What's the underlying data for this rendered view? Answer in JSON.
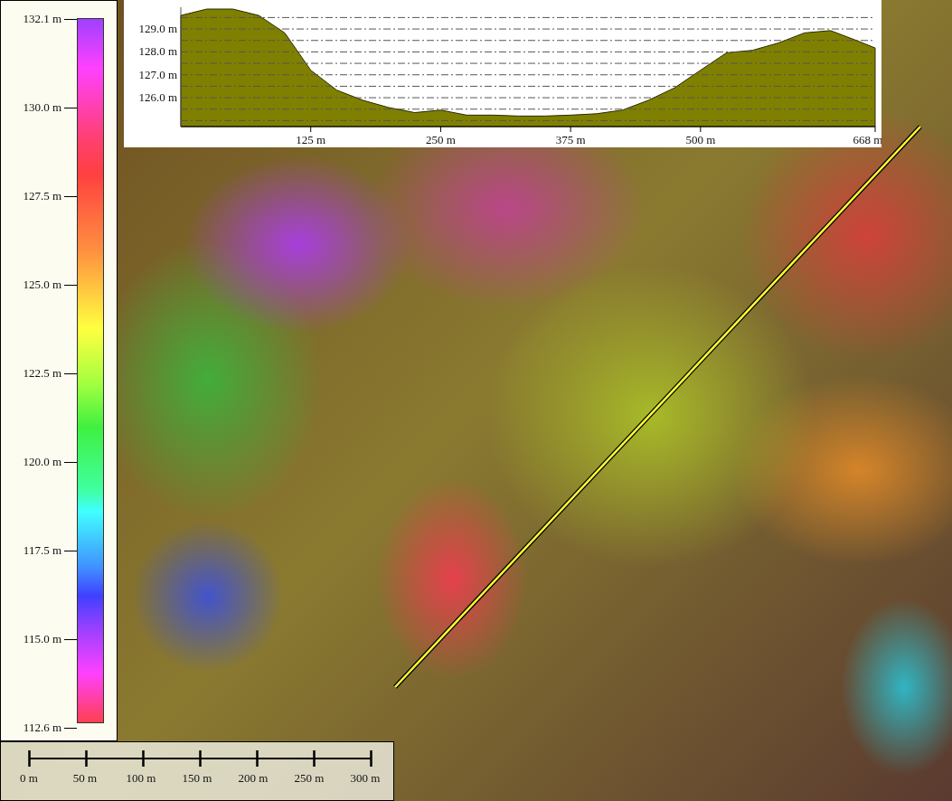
{
  "legend": {
    "labels": [
      "132.1 m",
      "130.0 m",
      "127.5 m",
      "125.0 m",
      "122.5 m",
      "120.0 m",
      "117.5 m",
      "115.0 m",
      "112.6 m"
    ]
  },
  "profile": {
    "chart_data": {
      "type": "area",
      "x": [
        0,
        25,
        50,
        75,
        100,
        125,
        150,
        175,
        200,
        225,
        250,
        275,
        300,
        325,
        350,
        375,
        400,
        425,
        450,
        475,
        500,
        525,
        550,
        575,
        600,
        625,
        650,
        668
      ],
      "values": [
        129.59,
        129.87,
        129.87,
        129.59,
        128.83,
        127.2,
        126.33,
        125.89,
        125.57,
        125.35,
        125.46,
        125.24,
        125.24,
        125.2,
        125.2,
        125.24,
        125.3,
        125.46,
        125.89,
        126.43,
        127.2,
        127.96,
        128.07,
        128.39,
        128.83,
        128.93,
        128.5,
        128.17
      ],
      "xlim": [
        0,
        668
      ],
      "ylim": [
        124.74,
        129.95
      ],
      "grid": true,
      "xticks": [
        {
          "value": 125,
          "label": "125 m"
        },
        {
          "value": 250,
          "label": "250 m"
        },
        {
          "value": 375,
          "label": "375 m"
        },
        {
          "value": 500,
          "label": "500 m"
        },
        {
          "value": 668,
          "label": "668 m"
        }
      ],
      "yticks": [
        {
          "value": 126,
          "label": "126.0 m"
        },
        {
          "value": 127,
          "label": "127.0 m"
        },
        {
          "value": 128,
          "label": "128.0 m"
        },
        {
          "value": 129,
          "label": "129.0 m"
        }
      ]
    }
  },
  "scale_bar": {
    "labels": [
      "0 m",
      "50 m",
      "100 m",
      "150 m",
      "200 m",
      "250 m",
      "300 m"
    ]
  }
}
